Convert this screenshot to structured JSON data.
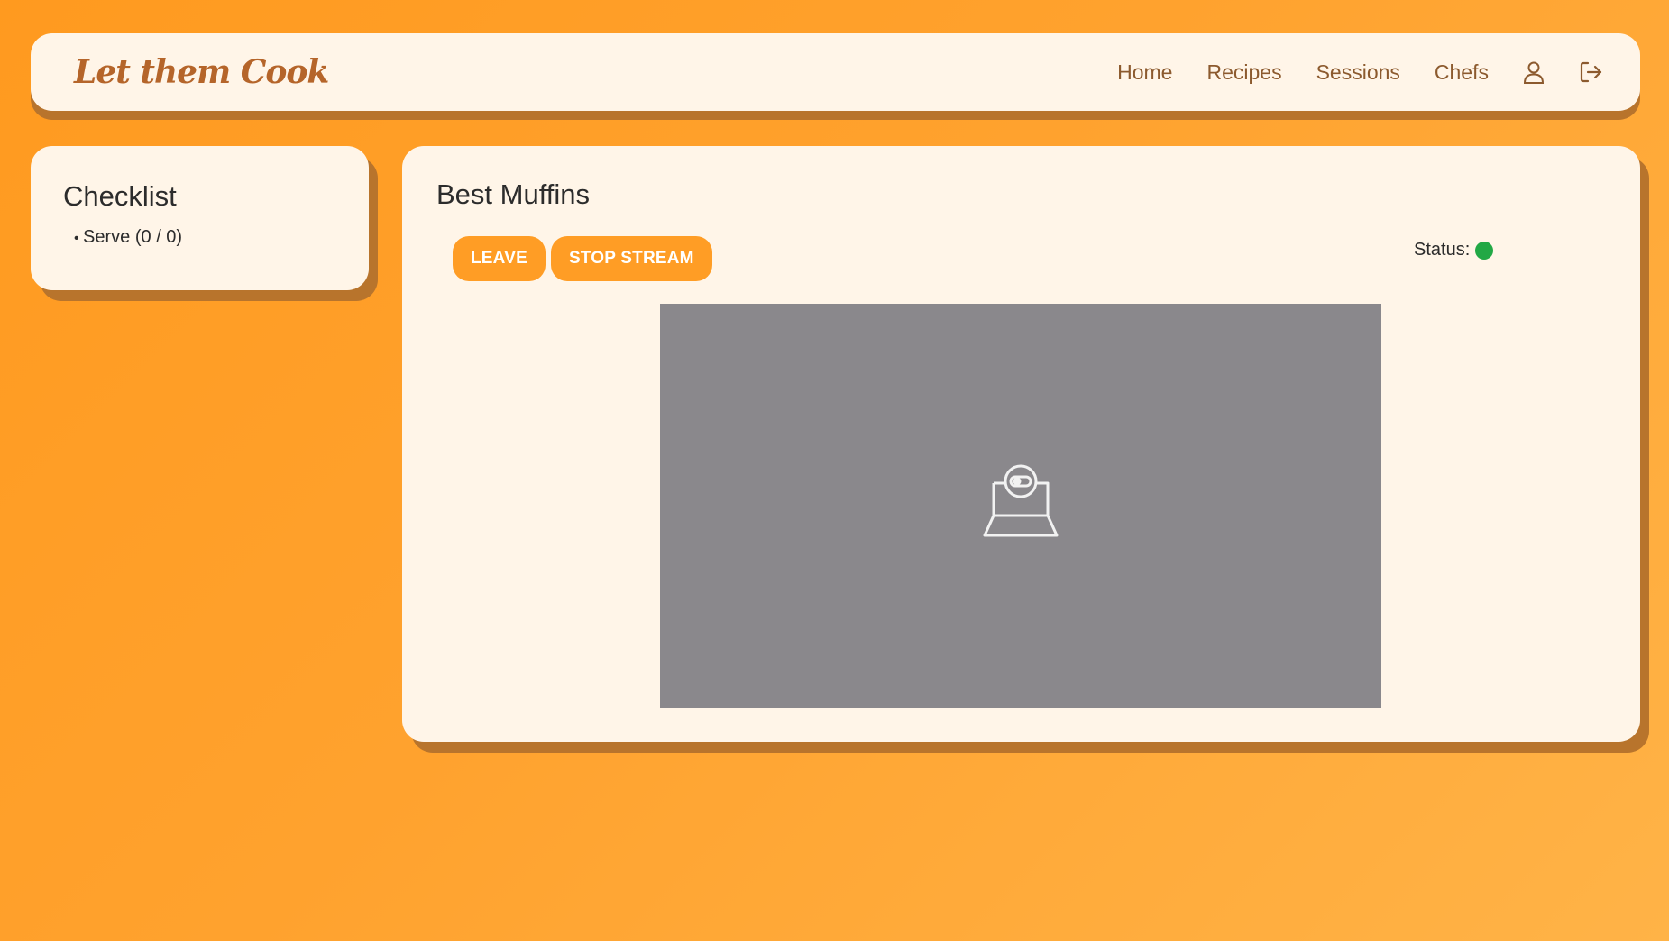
{
  "app": {
    "logo": "Let them Cook"
  },
  "nav": {
    "links": [
      "Home",
      "Recipes",
      "Sessions",
      "Chefs"
    ],
    "profile_icon": "user-icon",
    "logout_icon": "logout-icon"
  },
  "checklist": {
    "title": "Checklist",
    "items": [
      "Serve (0 / 0)"
    ]
  },
  "session": {
    "title": "Best Muffins",
    "leave_label": "LEAVE",
    "stop_stream_label": "STOP STREAM",
    "status_label": "Status:",
    "status_color": "#22a845",
    "video_placeholder_icon": "webcam-laptop-icon"
  },
  "colors": {
    "accent": "#ff9d25",
    "card": "#fff5e8",
    "nav_text": "#8c5a2e",
    "logo": "#b5652a",
    "video_bg": "#8a888c"
  }
}
